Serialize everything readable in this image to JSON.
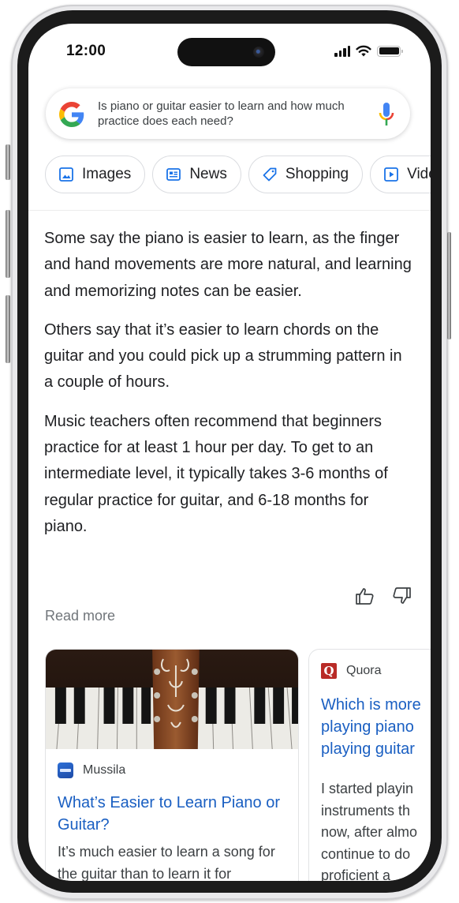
{
  "status_bar": {
    "time": "12:00",
    "icons": [
      "cellular-signal-icon",
      "wifi-icon",
      "battery-icon"
    ]
  },
  "search": {
    "logo": "google-g-logo",
    "query": "Is piano or guitar easier to learn and how much practice does each need?",
    "voice_icon": "microphone-icon"
  },
  "chips": [
    {
      "label": "Images",
      "icon": "image-icon"
    },
    {
      "label": "News",
      "icon": "newspaper-icon"
    },
    {
      "label": "Shopping",
      "icon": "tag-icon"
    },
    {
      "label": "Videos",
      "icon": "play-icon"
    }
  ],
  "answer": {
    "paragraphs": [
      "Some say the piano is easier to learn, as the finger and hand movements are more natural, and learning and memorizing notes can be easier.",
      "Others say that it’s easier to learn chords on the guitar and you could pick up a strumming pattern in a couple of hours.",
      "Music teachers often recommend that beginners practice for at least 1 hour per day. To get to an intermediate level, it typically takes 3-6 months of regular practice for guitar, and 6-18 months for piano."
    ],
    "feedback": {
      "thumbs_up": "thumbs-up-icon",
      "thumbs_down": "thumbs-down-icon"
    },
    "read_more": "Read more"
  },
  "results": [
    {
      "source": "Mussila",
      "title": "What’s Easier to Learn Piano or Guitar?",
      "snippet": "It’s much easier to learn a song for the guitar than to learn it for",
      "image": "guitar headstock resting on piano keys"
    },
    {
      "source": "Quora",
      "title": "Which is more playing piano playing guitar",
      "title_lines": [
        "Which is more",
        "playing piano",
        "playing guitar"
      ],
      "snippet_lines": [
        "I started playin",
        "instruments th",
        "now, after almo",
        "continue to do",
        "proficient a"
      ]
    }
  ],
  "colors": {
    "link_blue": "#1a5fc2",
    "text_primary": "#202124",
    "text_secondary": "#70757a",
    "icon_blue": "#1a73e8",
    "google_blue": "#4285F4",
    "google_red": "#EA4335",
    "google_yellow": "#FBBC05",
    "google_green": "#34A853",
    "quora_red": "#b92b27"
  }
}
